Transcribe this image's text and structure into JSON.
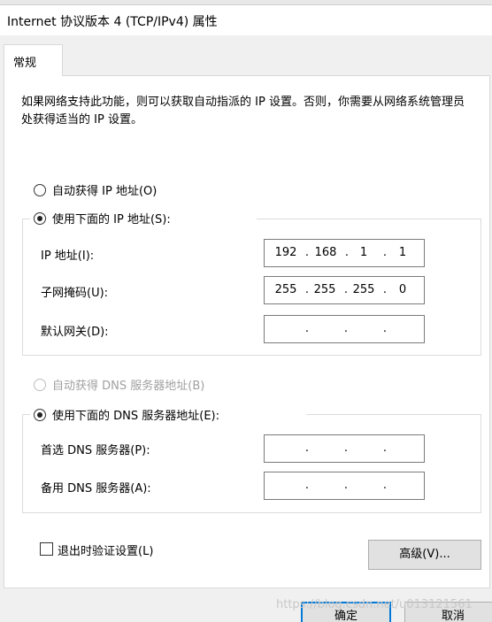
{
  "window": {
    "title": "Internet 协议版本 4 (TCP/IPv4) 属性"
  },
  "tabs": [
    {
      "label": "常规"
    }
  ],
  "description": "如果网络支持此功能，则可以获取自动指派的 IP 设置。否则，你需要从网络系统管理员处获得适当的 IP 设置。",
  "ip": {
    "auto_option": "自动获得 IP 地址(O)",
    "manual_option": "使用下面的 IP 地址(S):",
    "auto_selected": false,
    "manual_selected": true,
    "address_label": "IP 地址(I):",
    "address": [
      "192",
      "168",
      "1",
      "1"
    ],
    "subnet_label": "子网掩码(U):",
    "subnet": [
      "255",
      "255",
      "255",
      "0"
    ],
    "gateway_label": "默认网关(D):",
    "gateway": [
      "",
      "",
      "",
      ""
    ]
  },
  "dns": {
    "auto_option": "自动获得 DNS 服务器地址(B)",
    "auto_disabled": true,
    "manual_option": "使用下面的 DNS 服务器地址(E):",
    "manual_selected": true,
    "preferred_label": "首选 DNS 服务器(P):",
    "preferred": [
      "",
      "",
      "",
      ""
    ],
    "alternate_label": "备用 DNS 服务器(A):",
    "alternate": [
      "",
      "",
      "",
      ""
    ]
  },
  "validate_on_exit": {
    "label": "退出时验证设置(L)",
    "checked": false
  },
  "buttons": {
    "advanced": "高级(V)...",
    "ok": "确定",
    "cancel": "取消"
  },
  "watermark": "https://blog.csdn.net/u013121561",
  "colors": {
    "dialog_bg": "#f0f0f0",
    "panel_bg": "#ffffff",
    "disabled_text": "#a0a0a0",
    "focus_border": "#0078d7"
  }
}
